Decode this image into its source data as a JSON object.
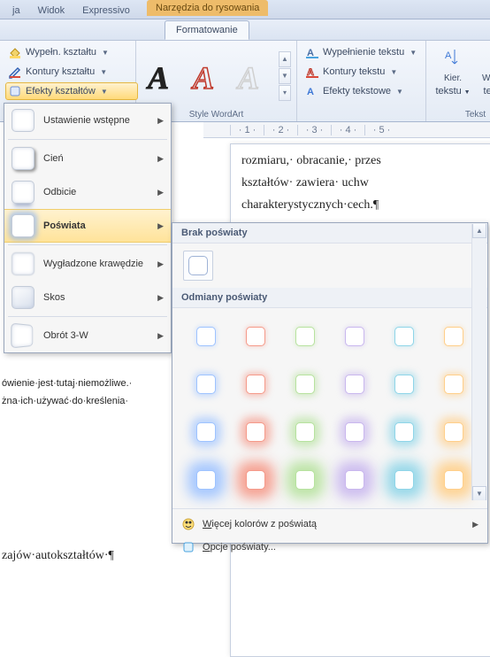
{
  "tabs_top": {
    "items": [
      "ja",
      "Widok",
      "Expressivo"
    ],
    "contextual": "Narzędzia do rysowania"
  },
  "tabs_second": {
    "active": "Formatowanie"
  },
  "ribbon": {
    "shape_styles": {
      "fill": "Wypełn. kształtu",
      "outline": "Kontury kształtu",
      "effects": "Efekty kształtów"
    },
    "wordart": {
      "group_label": "Style WordArt",
      "glyph": "A"
    },
    "text_fx": {
      "fill": "Wypełnienie tekstu",
      "outline": "Kontury tekstu",
      "effects": "Efekty tekstowe"
    },
    "direction": {
      "label1": "Kier.",
      "label2": "tekstu"
    },
    "align": {
      "label1": "Wyrówn",
      "label2": "tekst"
    },
    "text_group_label": "Tekst"
  },
  "effects_menu": {
    "items": [
      {
        "label": "Ustawienie wstępne"
      },
      {
        "label": "Cień"
      },
      {
        "label": "Odbicie"
      },
      {
        "label": "Poświata",
        "hover": true
      },
      {
        "label": "Wygładzone krawędzie"
      },
      {
        "label": "Skos"
      },
      {
        "label": "Obrót 3-W"
      }
    ]
  },
  "glow_flyout": {
    "none_title": "Brak poświaty",
    "variants_title": "Odmiany poświaty",
    "more_colors": "Więcej kolorów z poświatą",
    "options": "Opcje poświaty...",
    "colors": [
      "#9ec3ff",
      "#f59a8a",
      "#b7e29f",
      "#c9b7ee",
      "#8fd5e8",
      "#ffcf8a"
    ],
    "row_glow": [
      {
        "blur": 1,
        "alpha": 0.35
      },
      {
        "blur": 3,
        "alpha": 0.5
      },
      {
        "blur": 6,
        "alpha": 0.7
      },
      {
        "blur": 10,
        "alpha": 0.9
      }
    ]
  },
  "ruler": {
    "marks": [
      "1",
      "2",
      "3",
      "4",
      "5"
    ]
  },
  "document": {
    "line1": "rozmiaru,· obracanie,· przes",
    "line2": "kształtów· zawiera· uchw",
    "line3": "charakterystycznych·cech.¶",
    "left1": "ówienie·jest·tutaj·niemożliwe.·",
    "left2": "żna·ich·używać·do·kreślenia·",
    "bottom": "zajów·autokształtów·¶"
  }
}
